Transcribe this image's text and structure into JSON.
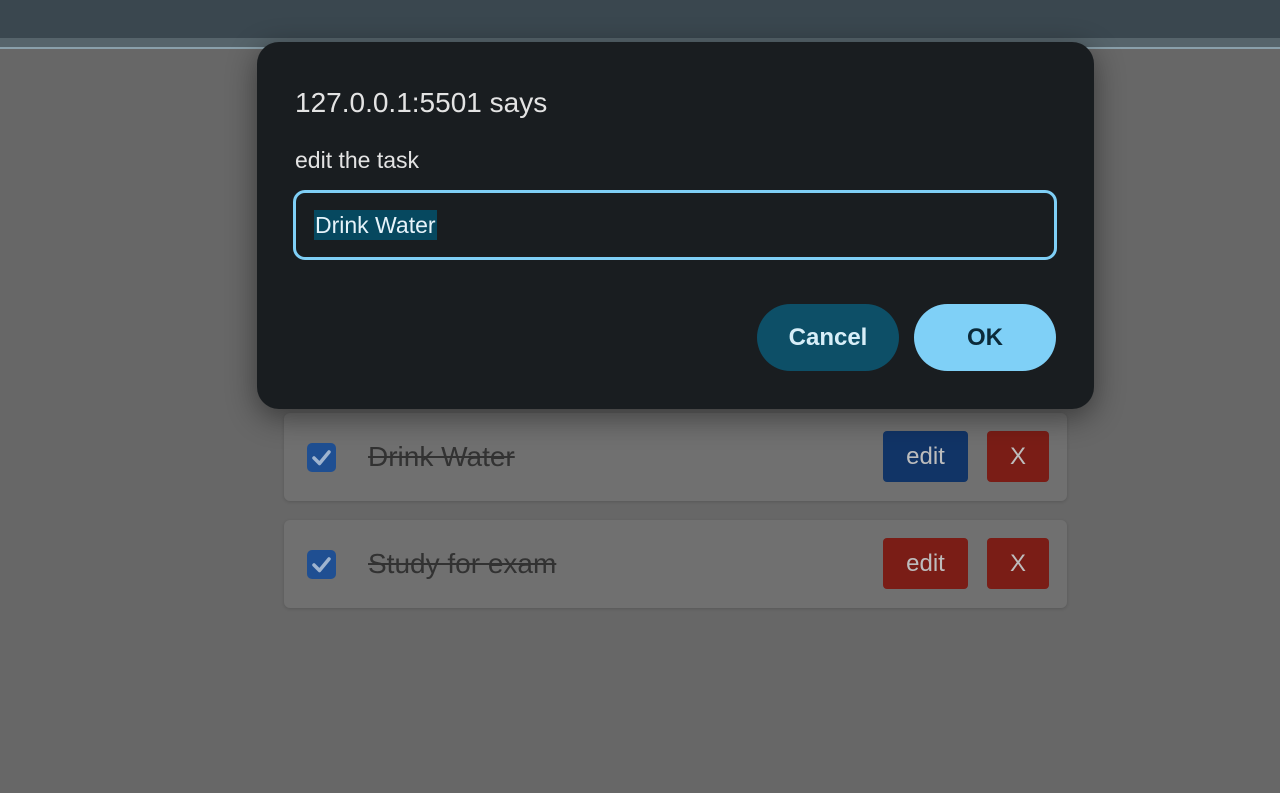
{
  "dialog": {
    "title": "127.0.0.1:5501 says",
    "message": "edit the task",
    "input_value": "Drink Water",
    "cancel_label": "Cancel",
    "ok_label": "OK"
  },
  "tasks": [
    {
      "label": "Drink Water",
      "checked": true,
      "edit_label": "edit",
      "delete_label": "X",
      "edit_color": "#113466"
    },
    {
      "label": "Study for exam",
      "checked": true,
      "edit_label": "edit",
      "delete_label": "X",
      "edit_color": "#7a1d16"
    }
  ],
  "icons": {
    "checkbox": "check-icon"
  },
  "colors": {
    "accent": "#7fd0f7",
    "dialog_bg": "#191d20",
    "delete_button": "#7a1d16"
  }
}
